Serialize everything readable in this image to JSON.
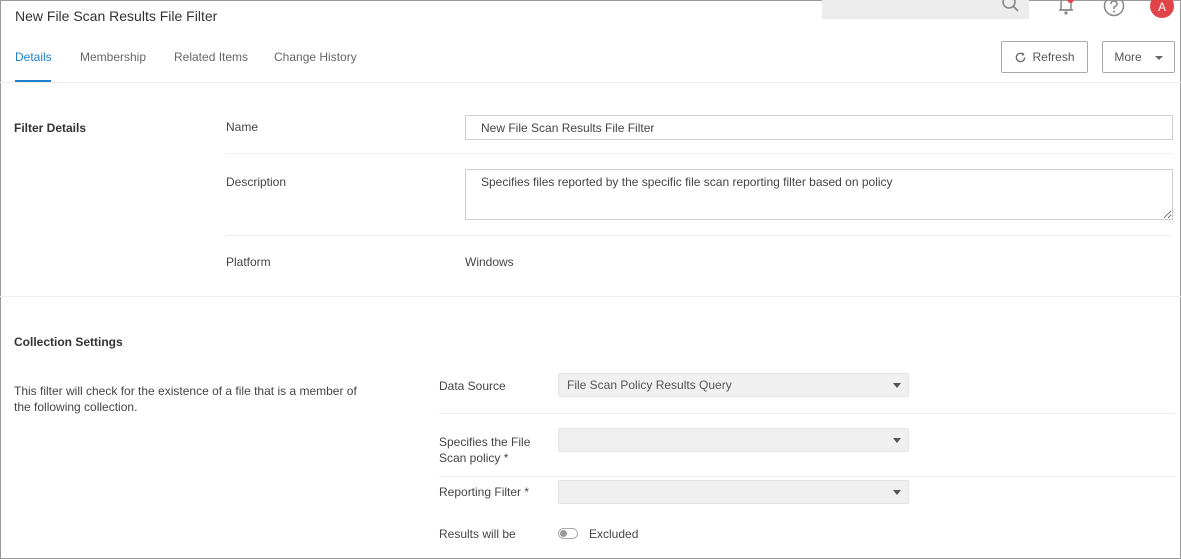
{
  "header": {
    "title": "New File Scan Results File Filter",
    "search_icon": "search-icon",
    "notification_icon": "bell-icon",
    "help_icon": "help-icon",
    "avatar_initial": "A",
    "avatar_color": "#e0444a"
  },
  "tabs": [
    {
      "label": "Details",
      "active": true
    },
    {
      "label": "Membership",
      "active": false
    },
    {
      "label": "Related Items",
      "active": false
    },
    {
      "label": "Change History",
      "active": false
    }
  ],
  "toolbar": {
    "refresh_label": "Refresh",
    "more_label": "More"
  },
  "filter_details": {
    "heading": "Filter Details",
    "name_label": "Name",
    "name_value": "New File Scan Results File Filter",
    "description_label": "Description",
    "description_value": "Specifies files reported by the specific file scan reporting filter based on policy",
    "platform_label": "Platform",
    "platform_value": "Windows"
  },
  "collection_settings": {
    "heading": "Collection Settings",
    "help_text": "This filter will check for the existence of a file that is a member of the following collection.",
    "data_source_label": "Data Source",
    "data_source_value": "File Scan Policy Results Query",
    "policy_label": "Specifies the File Scan policy *",
    "policy_value": "",
    "reporting_filter_label": "Reporting Filter *",
    "reporting_filter_value": "",
    "results_label": "Results will be",
    "results_value": "Excluded",
    "results_toggle_on": false
  },
  "colors": {
    "accent": "#1e7fd0"
  }
}
